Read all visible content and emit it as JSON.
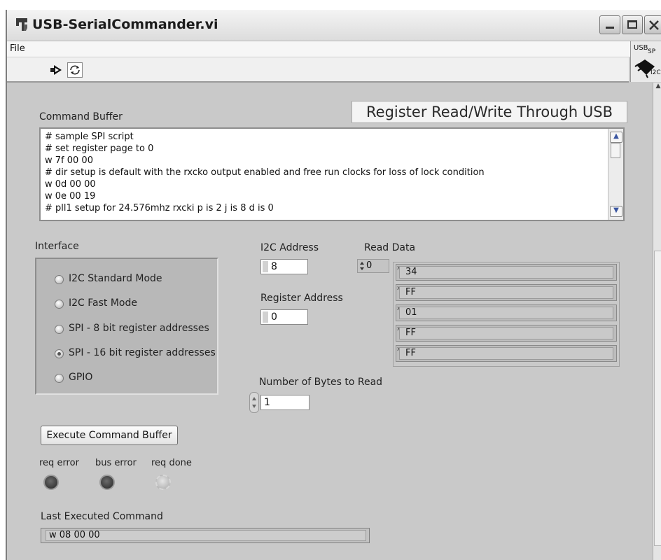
{
  "window": {
    "title": "USB-SerialCommander.vi",
    "minimize_glyph": "_",
    "maximize_glyph": "□",
    "close_glyph": "X"
  },
  "menu": {
    "file": "File"
  },
  "toolbar": {
    "run_icon": "run-arrow-icon",
    "continuous_run_icon": "continuous-run-icon"
  },
  "side_icon": {
    "label_top": "USB",
    "label_sub": "SP",
    "label_bottom": "I2C"
  },
  "panel": {
    "header_title": "Register Read/Write Through USB",
    "command_buffer": {
      "label": "Command Buffer",
      "lines": [
        "# sample SPI script",
        "# set register page to 0",
        "w 7f 00 00",
        "# dir setup is default with the rxcko output enabled and free run clocks for loss of lock condition",
        "w 0d 00 00",
        "w 0e 00 19",
        "# pll1 setup for 24.576mhz rxcki p is 2 j is 8 d is 0"
      ]
    },
    "interface": {
      "label": "Interface",
      "options": [
        {
          "label": "I2C Standard Mode",
          "selected": false
        },
        {
          "label": "I2C Fast Mode",
          "selected": false
        },
        {
          "label": "SPI - 8 bit register addresses",
          "selected": false
        },
        {
          "label": "SPI - 16 bit register addresses",
          "selected": true
        },
        {
          "label": "GPIO",
          "selected": false
        }
      ]
    },
    "i2c_address": {
      "label": "I2C Address",
      "value": "8"
    },
    "register_address": {
      "label": "Register Address",
      "value": "0"
    },
    "num_bytes": {
      "label": "Number of Bytes to Read",
      "value": "1"
    },
    "read_data": {
      "label": "Read Data",
      "index": "0",
      "values": [
        "34",
        "FF",
        "01",
        "FF",
        "FF"
      ]
    },
    "execute_button": "Execute Command Buffer",
    "indicators": [
      {
        "label": "req error",
        "state": "off"
      },
      {
        "label": "bus error",
        "state": "off"
      },
      {
        "label": "req done",
        "state": "dim"
      }
    ],
    "last_executed": {
      "label": "Last Executed Command",
      "value": "w 08 00 00"
    }
  }
}
